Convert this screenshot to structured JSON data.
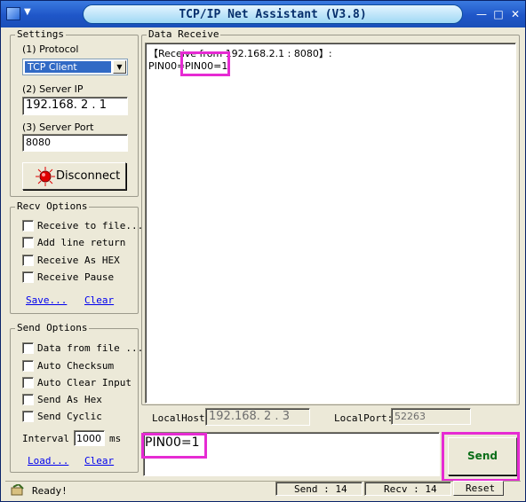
{
  "window": {
    "title": "TCP/IP Net Assistant (V3.8)",
    "sysmenu_glyph": "▼",
    "minimize": "—",
    "maximize": "□",
    "close": "✕"
  },
  "settings": {
    "legend": "Settings",
    "protocol_label": "(1) Protocol",
    "protocol_value": "TCP Client",
    "server_ip_label": "(2) Server IP",
    "server_ip_value": "192.168. 2 . 1",
    "server_port_label": "(3) Server Port",
    "server_port_value": "8080",
    "disconnect_label": "Disconnect"
  },
  "recv_options": {
    "legend": "Recv Options",
    "items": [
      "Receive to file...",
      "Add line return",
      "Receive As HEX",
      "Receive Pause"
    ],
    "save_link": "Save...",
    "clear_link": "Clear"
  },
  "send_options": {
    "legend": "Send Options",
    "items": [
      "Data from file ...",
      "Auto Checksum",
      "Auto Clear Input",
      "Send As Hex",
      "Send Cyclic"
    ],
    "interval_label": "Interval",
    "interval_value": "1000",
    "interval_unit": "ms",
    "load_link": "Load...",
    "clear_link": "Clear"
  },
  "data_receive": {
    "legend": "Data Receive",
    "header_line": "【Receive from 192.168.2.1 : 8080】:",
    "line_prefix": "PIN00=",
    "line_highlight": "PIN00=1"
  },
  "local": {
    "host_label": "LocalHost:",
    "host_value": "192.168. 2 . 3",
    "port_label": "LocalPort:",
    "port_value": "52263"
  },
  "send": {
    "input_value": "PIN00=1",
    "button_label": "Send"
  },
  "status": {
    "text": "Ready!",
    "send_count": "Send : 14",
    "recv_count": "Recv : 14",
    "reset_label": "Reset"
  },
  "colors": {
    "highlight": "#e62bd3",
    "send_text": "#0a6e18",
    "title_bar": "#1f56c8",
    "dialog": "#ece9d8"
  }
}
